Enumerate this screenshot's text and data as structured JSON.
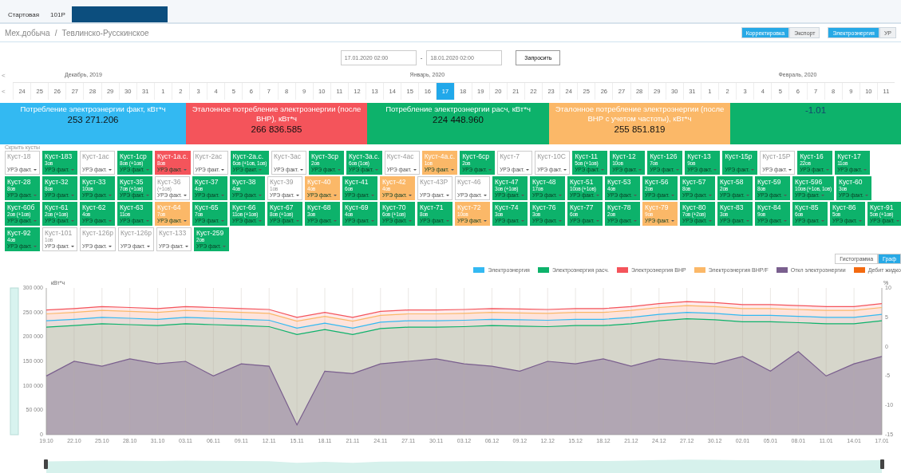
{
  "top_tabs": [
    {
      "label": "Стартовая",
      "selected": false
    },
    {
      "label": "101Р",
      "selected": false
    },
    {
      "selected": true
    }
  ],
  "breadcrumb": {
    "items": [
      "Мех.добыча",
      "Тевлинско-Русскинское"
    ],
    "separator": "/"
  },
  "actions": [
    {
      "label": "Корректировка",
      "selected": true
    },
    {
      "label": "Экспорт",
      "selected": false
    }
  ],
  "views": [
    {
      "label": "Электроэнергия",
      "selected": true
    },
    {
      "label": "УР",
      "selected": false
    }
  ],
  "period": {
    "from": "17.01.2020 02:00",
    "dash": "-",
    "to": "18.01.2020 02:00",
    "button": "Запросить"
  },
  "calendar": {
    "prev_month": "<",
    "prev_day": "<",
    "months": [
      {
        "label": "Декабрь, 2019",
        "days": [
          {
            "label": "24",
            "selected": false
          },
          {
            "label": "25",
            "selected": false
          },
          {
            "label": "26",
            "selected": false
          },
          {
            "label": "27",
            "selected": false
          },
          {
            "label": "28",
            "selected": false
          },
          {
            "label": "29",
            "selected": false
          },
          {
            "label": "30",
            "selected": false
          },
          {
            "label": "31",
            "selected": false
          }
        ]
      },
      {
        "label": "Январь, 2020",
        "days": [
          {
            "label": "1",
            "selected": false
          },
          {
            "label": "2",
            "selected": false
          },
          {
            "label": "3",
            "selected": false
          },
          {
            "label": "4",
            "selected": false
          },
          {
            "label": "5",
            "selected": false
          },
          {
            "label": "6",
            "selected": false
          },
          {
            "label": "7",
            "selected": false
          },
          {
            "label": "8",
            "selected": false
          },
          {
            "label": "9",
            "selected": false
          },
          {
            "label": "10",
            "selected": false
          },
          {
            "label": "11",
            "selected": false
          },
          {
            "label": "12",
            "selected": false
          },
          {
            "label": "13",
            "selected": false
          },
          {
            "label": "14",
            "selected": false
          },
          {
            "label": "15",
            "selected": false
          },
          {
            "label": "16",
            "selected": false
          },
          {
            "label": "17",
            "selected": true
          },
          {
            "label": "18",
            "selected": false
          },
          {
            "label": "19",
            "selected": false
          },
          {
            "label": "20",
            "selected": false
          },
          {
            "label": "21",
            "selected": false
          },
          {
            "label": "22",
            "selected": false
          },
          {
            "label": "23",
            "selected": false
          },
          {
            "label": "24",
            "selected": false
          },
          {
            "label": "25",
            "selected": false
          },
          {
            "label": "26",
            "selected": false
          },
          {
            "label": "27",
            "selected": false
          },
          {
            "label": "28",
            "selected": false
          },
          {
            "label": "29",
            "selected": false
          },
          {
            "label": "30",
            "selected": false
          },
          {
            "label": "31",
            "selected": false
          }
        ]
      },
      {
        "label": "Февраль, 2020",
        "days": [
          {
            "label": "1",
            "selected": false
          },
          {
            "label": "2",
            "selected": false
          },
          {
            "label": "3",
            "selected": false
          },
          {
            "label": "4",
            "selected": false
          },
          {
            "label": "5",
            "selected": false
          },
          {
            "label": "6",
            "selected": false
          },
          {
            "label": "7",
            "selected": false
          },
          {
            "label": "8",
            "selected": false
          },
          {
            "label": "9",
            "selected": false
          },
          {
            "label": "10",
            "selected": false
          },
          {
            "label": "11",
            "selected": false
          }
        ]
      }
    ]
  },
  "kpis": [
    {
      "title": "Потребление электроэнергии факт, кВт*ч",
      "value": "253 271.206",
      "color": "#33b9f2",
      "kind": "plain"
    },
    {
      "title": "Эталонное потребление электроэнергии (после ВНР), кВт*ч",
      "value": "266 836.585",
      "color": "#f4545b",
      "kind": "plain"
    },
    {
      "title": "Потребление электроэнергии расч, кВт*ч",
      "value": "224 448.960",
      "color": "#0db26b",
      "kind": "plain"
    },
    {
      "title": "Эталонное потребление электроэнергии (после ВНР с учетом частоты), кВт*ч",
      "value": "255 851.819",
      "color": "#fbb868",
      "kind": "plain"
    },
    {
      "value": "-1.01",
      "color": "#0db26b",
      "kind": "delta"
    }
  ],
  "clusters": {
    "hide_label": "Скрыть кусты",
    "rows": [
      [
        {
          "name": "Куст-18",
          "metric": "УРЭ факт.",
          "color": "#ffffff"
        },
        {
          "name": "Куст-183",
          "wells": "3ов",
          "metric": "УРЭ факт.",
          "color": "#0db26b"
        },
        {
          "name": "Куст-1ас",
          "metric": "УРЭ факт.",
          "color": "#ffffff"
        },
        {
          "name": "Куст-1ср",
          "wells": "8ов (+1ов)",
          "metric": "УРЭ факт.",
          "color": "#0db26b"
        },
        {
          "name": "Куст-1а.с.",
          "wells": "8ов",
          "metric": "УРЭ факт.",
          "color": "#f4545b"
        },
        {
          "name": "Куст-2ас",
          "metric": "УРЭ факт.",
          "color": "#ffffff"
        },
        {
          "name": "Куст-2а.с.",
          "wells": "6ов (+1ов, 1ов)",
          "metric": "УРЭ факт.",
          "color": "#0db26b"
        },
        {
          "name": "Куст-3ас",
          "metric": "УРЭ факт.",
          "color": "#ffffff"
        },
        {
          "name": "Куст-3ср",
          "wells": "2ов",
          "metric": "УРЭ факт.",
          "color": "#0db26b"
        },
        {
          "name": "Куст-3а.с.",
          "wells": "6ов (1ов)",
          "metric": "УРЭ факт.",
          "color": "#0db26b"
        },
        {
          "name": "Куст-4ас",
          "metric": "УРЭ факт.",
          "color": "#ffffff"
        },
        {
          "name": "Куст-4а.с.",
          "wells": "1ов",
          "metric": "УРЭ факт.",
          "color": "#fbb868"
        },
        {
          "name": "Куст-6ср",
          "wells": "2ов",
          "metric": "УРЭ факт.",
          "color": "#0db26b"
        },
        {
          "name": "Куст-7",
          "metric": "УРЭ факт.",
          "color": "#ffffff"
        },
        {
          "name": "Куст-10С",
          "metric": "УРЭ факт.",
          "color": "#ffffff"
        },
        {
          "name": "Куст-11",
          "wells": "5ов (+1ов)",
          "metric": "УРЭ факт.",
          "color": "#0db26b"
        },
        {
          "name": "Куст-12",
          "wells": "10ов",
          "metric": "УРЭ факт.",
          "color": "#0db26b"
        },
        {
          "name": "Куст-126",
          "wells": "7ов",
          "metric": "УРЭ факт.",
          "color": "#0db26b"
        },
        {
          "name": "Куст-13",
          "wells": "9ов",
          "metric": "УРЭ факт.",
          "color": "#0db26b"
        },
        {
          "name": "Куст-15р",
          "metric": "УРЭ факт.",
          "color": "#0db26b"
        },
        {
          "name": "Куст-15Р",
          "metric": "УРЭ факт.",
          "color": "#ffffff"
        },
        {
          "name": "Куст-16",
          "wells": "22ов",
          "metric": "УРЭ факт.",
          "color": "#0db26b"
        },
        {
          "name": "Куст-17",
          "wells": "11ов",
          "metric": "УРЭ факт.",
          "color": "#0db26b"
        }
      ],
      [
        {
          "name": "Куст-28",
          "wells": "8ов",
          "metric": "УРЭ факт.",
          "color": "#0db26b"
        },
        {
          "name": "Куст-32",
          "wells": "8ов",
          "metric": "УРЭ факт.",
          "color": "#0db26b"
        },
        {
          "name": "Куст-33",
          "wells": "10ов",
          "metric": "УРЭ факт.",
          "color": "#0db26b"
        },
        {
          "name": "Куст-35",
          "wells": "7ов (+1ов)",
          "metric": "УРЭ факт.",
          "color": "#0db26b"
        },
        {
          "name": "Куст-36",
          "wells": "(+1ов)",
          "metric": "УРЭ факт.",
          "color": "#ffffff"
        },
        {
          "name": "Куст-37",
          "wells": "4ов",
          "metric": "УРЭ факт.",
          "color": "#0db26b"
        },
        {
          "name": "Куст-38",
          "wells": "4ов",
          "metric": "УРЭ факт.",
          "color": "#0db26b"
        },
        {
          "name": "Куст-39",
          "wells": "1ов",
          "metric": "УРЭ факт.",
          "color": "#ffffff"
        },
        {
          "name": "Куст-40",
          "wells": "4ов",
          "metric": "УРЭ факт.",
          "color": "#fbb868"
        },
        {
          "name": "Куст-41",
          "wells": "6ов",
          "metric": "УРЭ факт.",
          "color": "#0db26b"
        },
        {
          "name": "Куст-42",
          "wells": "4ов",
          "metric": "УРЭ факт.",
          "color": "#fbb868"
        },
        {
          "name": "Куст-43Р",
          "metric": "УРЭ факт.",
          "color": "#ffffff"
        },
        {
          "name": "Куст-46",
          "metric": "УРЭ факт.",
          "color": "#ffffff"
        },
        {
          "name": "Куст-47",
          "wells": "3ов (+1ов)",
          "metric": "УРЭ факт.",
          "color": "#0db26b"
        },
        {
          "name": "Куст-48",
          "wells": "17ов",
          "metric": "УРЭ факт.",
          "color": "#0db26b"
        },
        {
          "name": "Куст-51",
          "wells": "10ов (+1ов)",
          "metric": "УРЭ факт.",
          "color": "#0db26b"
        },
        {
          "name": "Куст-53",
          "wells": "4ов",
          "metric": "УРЭ факт.",
          "color": "#0db26b"
        },
        {
          "name": "Куст-56",
          "wells": "2ов",
          "metric": "УРЭ факт.",
          "color": "#0db26b"
        },
        {
          "name": "Куст-57",
          "wells": "8ов",
          "metric": "УРЭ факт.",
          "color": "#0db26b"
        },
        {
          "name": "Куст-58",
          "wells": "2ов",
          "metric": "УРЭ факт.",
          "color": "#0db26b"
        },
        {
          "name": "Куст-59",
          "wells": "8ов",
          "metric": "УРЭ факт.",
          "color": "#0db26b"
        },
        {
          "name": "Куст-596",
          "wells": "10ов (+1ов, 1ов)",
          "metric": "УРЭ факт.",
          "color": "#0db26b"
        },
        {
          "name": "Куст-60",
          "wells": "3ов",
          "metric": "УРЭ факт.",
          "color": "#0db26b"
        }
      ],
      [
        {
          "name": "Куст-60б",
          "wells": "2ов (+1ов)",
          "metric": "УРЭ факт.",
          "color": "#0db26b"
        },
        {
          "name": "Куст-61",
          "wells": "2ов (+1ов)",
          "metric": "УРЭ факт.",
          "color": "#0db26b"
        },
        {
          "name": "Куст-62",
          "wells": "4ов",
          "metric": "УРЭ факт.",
          "color": "#0db26b"
        },
        {
          "name": "Куст-63",
          "wells": "11ов",
          "metric": "УРЭ факт.",
          "color": "#0db26b"
        },
        {
          "name": "Куст-64",
          "wells": "7ов",
          "metric": "УРЭ факт.",
          "color": "#fbb868"
        },
        {
          "name": "Куст-65",
          "wells": "7ов",
          "metric": "УРЭ факт.",
          "color": "#0db26b"
        },
        {
          "name": "Куст-66",
          "wells": "11ов (+1ов)",
          "metric": "УРЭ факт.",
          "color": "#0db26b"
        },
        {
          "name": "Куст-67",
          "wells": "8ов (+1ов)",
          "metric": "УРЭ факт.",
          "color": "#0db26b"
        },
        {
          "name": "Куст-68",
          "wells": "3ов",
          "metric": "УРЭ факт.",
          "color": "#0db26b"
        },
        {
          "name": "Куст-69",
          "wells": "4ов",
          "metric": "УРЭ факт.",
          "color": "#0db26b"
        },
        {
          "name": "Куст-70",
          "wells": "6ов (+1ов)",
          "metric": "УРЭ факт.",
          "color": "#0db26b"
        },
        {
          "name": "Куст-71",
          "wells": "8ов",
          "metric": "УРЭ факт.",
          "color": "#0db26b"
        },
        {
          "name": "Куст-72",
          "wells": "10ов",
          "metric": "УРЭ факт.",
          "color": "#fbb868"
        },
        {
          "name": "Куст-74",
          "wells": "3ов",
          "metric": "УРЭ факт.",
          "color": "#0db26b"
        },
        {
          "name": "Куст-76",
          "wells": "3ов",
          "metric": "УРЭ факт.",
          "color": "#0db26b"
        },
        {
          "name": "Куст-77",
          "wells": "6ов",
          "metric": "УРЭ факт.",
          "color": "#0db26b"
        },
        {
          "name": "Куст-78",
          "wells": "2ов",
          "metric": "УРЭ факт.",
          "color": "#0db26b"
        },
        {
          "name": "Куст-79",
          "wells": "9ов",
          "metric": "УРЭ факт.",
          "color": "#fbb868"
        },
        {
          "name": "Куст-80",
          "wells": "7ов (+2ов)",
          "metric": "УРЭ факт.",
          "color": "#0db26b"
        },
        {
          "name": "Куст-83",
          "wells": "3ов",
          "metric": "УРЭ факт.",
          "color": "#0db26b"
        },
        {
          "name": "Куст-84",
          "wells": "9ов",
          "metric": "УРЭ факт.",
          "color": "#0db26b"
        },
        {
          "name": "Куст-85",
          "wells": "6ов",
          "metric": "УРЭ факт.",
          "color": "#0db26b"
        },
        {
          "name": "Куст-86",
          "wells": "5ов",
          "metric": "УРЭ факт.",
          "color": "#0db26b"
        },
        {
          "name": "Куст-91",
          "wells": "5ов (+1ов)",
          "metric": "УРЭ факт.",
          "color": "#0db26b"
        }
      ],
      [
        {
          "name": "Куст-92",
          "wells": "4ов",
          "metric": "УРЭ факт.",
          "color": "#0db26b"
        },
        {
          "name": "Куст-101",
          "wells": "1ов",
          "metric": "УРЭ факт.",
          "color": "#ffffff"
        },
        {
          "name": "Куст-126р",
          "metric": "УРЭ факт.",
          "color": "#ffffff"
        },
        {
          "name": "Куст-126р",
          "metric": "УРЭ факт.",
          "color": "#ffffff"
        },
        {
          "name": "Куст-133",
          "metric": "УРЭ факт.",
          "color": "#ffffff"
        },
        {
          "name": "Куст-259",
          "wells": "2ов",
          "metric": "УРЭ факт.",
          "color": "#0db26b"
        }
      ]
    ]
  },
  "chart": {
    "view_toggle": [
      {
        "label": "Гистограмма",
        "selected": false
      },
      {
        "label": "Граф",
        "selected": true
      }
    ],
    "y_unit": "кВт*ч",
    "y2_unit": "%",
    "y2ticks": [
      "10",
      "5",
      "0",
      "-5",
      "-10",
      "-15"
    ],
    "chart_data": {
      "type": "area",
      "grid": true,
      "categories": [
        "19.10",
        "22.10",
        "25.10",
        "28.10",
        "31.10",
        "03.11",
        "06.11",
        "09.11",
        "12.11",
        "15.11",
        "18.11",
        "21.11",
        "24.11",
        "27.11",
        "30.11",
        "03.12",
        "06.12",
        "09.12",
        "12.12",
        "15.12",
        "18.12",
        "21.12",
        "24.12",
        "27.12",
        "30.12",
        "02.01",
        "05.01",
        "08.01",
        "11.01",
        "14.01",
        "17.01"
      ],
      "ylim": [
        0,
        300000
      ],
      "yticks": [
        {
          "value": 0,
          "label": "0"
        },
        {
          "value": 50000,
          "label": "50 000"
        },
        {
          "value": 100000,
          "label": "100 000"
        },
        {
          "value": 150000,
          "label": "150 000"
        },
        {
          "value": 200000,
          "label": "200 000"
        },
        {
          "value": 250000,
          "label": "250 000"
        },
        {
          "value": 300000,
          "label": "300 000"
        }
      ],
      "series": [
        {
          "name": "Электроэнергия",
          "color": "#33b9f2",
          "values": [
            233000,
            236000,
            240000,
            238000,
            236000,
            240000,
            238000,
            236000,
            234000,
            218000,
            228000,
            218000,
            230000,
            233000,
            233000,
            234000,
            236000,
            235000,
            234000,
            236000,
            236000,
            240000,
            246000,
            250000,
            248000,
            244000,
            244000,
            242000,
            240000,
            240000,
            246000
          ]
        },
        {
          "name": "Электроэнергия расч.",
          "color": "#0db26b",
          "values": [
            220000,
            223000,
            227000,
            225000,
            223000,
            227000,
            225000,
            223000,
            221000,
            205000,
            215000,
            205000,
            217000,
            220000,
            220000,
            221000,
            223000,
            222000,
            221000,
            223000,
            223000,
            227000,
            233000,
            237000,
            235000,
            231000,
            231000,
            229000,
            227000,
            227000,
            233000
          ]
        },
        {
          "name": "Электроэнергия ВНР",
          "color": "#f4545b",
          "values": [
            255000,
            258000,
            262000,
            260000,
            258000,
            262000,
            260000,
            258000,
            256000,
            240000,
            250000,
            240000,
            252000,
            255000,
            255000,
            256000,
            258000,
            257000,
            256000,
            258000,
            258000,
            262000,
            268000,
            272000,
            270000,
            266000,
            266000,
            264000,
            262000,
            262000,
            268000
          ]
        },
        {
          "name": "Электроэнергия ВНР/F",
          "color": "#fbb868",
          "values": [
            247000,
            250000,
            254000,
            252000,
            250000,
            254000,
            252000,
            250000,
            248000,
            232000,
            242000,
            232000,
            244000,
            247000,
            247000,
            248000,
            250000,
            249000,
            248000,
            250000,
            250000,
            254000,
            260000,
            264000,
            262000,
            258000,
            258000,
            256000,
            254000,
            254000,
            260000
          ]
        },
        {
          "name": "Откл электроэнергии",
          "color": "#7a5f8e",
          "values": [
            120000,
            150000,
            140000,
            155000,
            145000,
            150000,
            120000,
            145000,
            140000,
            20000,
            130000,
            125000,
            145000,
            150000,
            155000,
            145000,
            140000,
            130000,
            150000,
            145000,
            155000,
            140000,
            155000,
            150000,
            145000,
            160000,
            130000,
            170000,
            120000,
            145000,
            160000
          ]
        },
        {
          "name": "Дебит жидко",
          "color": "#f36a10",
          "values": [
            null,
            null,
            null,
            null,
            null,
            null,
            null,
            null,
            null,
            null,
            null,
            null,
            null,
            null,
            null,
            null,
            null,
            null,
            null,
            null,
            null,
            null,
            null,
            null,
            null,
            null,
            null,
            null,
            null,
            null,
            null
          ]
        }
      ]
    }
  }
}
